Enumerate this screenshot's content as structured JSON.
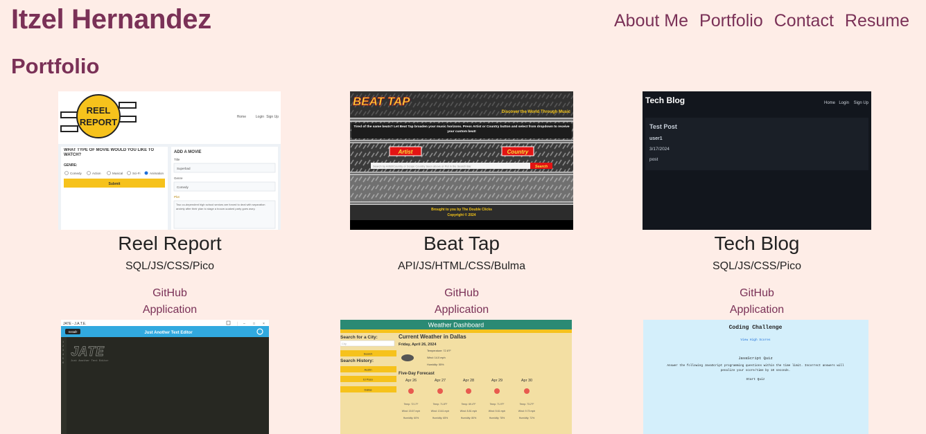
{
  "header": {
    "site_title": "Itzel Hernandez",
    "nav": [
      "About Me",
      "Portfolio",
      "Contact",
      "Resume"
    ]
  },
  "section_title": "Portfolio",
  "projects": [
    {
      "title": "Reel Report",
      "stack": "SQL/JS/CSS/Pico",
      "github": "GitHub",
      "app": "Application",
      "thumb": {
        "logo_line1": "REEL",
        "logo_line2": "REPORT",
        "nav": [
          "Home",
          "Login",
          "Sign Up"
        ],
        "question": "WHAT TYPE OF MOVIE WOULD YOU LIKE TO WATCH?",
        "genre_label": "GENRE:",
        "genres": [
          "Comedy",
          "Action",
          "Musical",
          "Sci-Fi",
          "Animation"
        ],
        "submit": "Submit",
        "add_title": "ADD A MOVIE",
        "field_title_label": "Title",
        "field_title_value": "Superbad",
        "field_genre_label": "Genre",
        "field_genre_value": "Comedy",
        "field_plot_label": "Plot",
        "field_plot_value": "Two co-dependent high school seniors are forced to deal with separation anxiety after their plan to stage a booze-soaked party goes awry."
      }
    },
    {
      "title": "Beat Tap",
      "stack": "API/JS/HTML/CSS/Bulma",
      "github": "GitHub",
      "app": "Application",
      "thumb": {
        "logo": "BEAT TAP",
        "tagline": "Discover the World Through Music",
        "intro": "Tired of the same beats? Let Beat Tap broaden your music horizons. Press Artist or Country button and select from dropdown to receive your custom beat!",
        "artist_button": "Artist",
        "country_button": "Country",
        "search_placeholder": "Search by Artist/Country or Scope Country Seen above or Put in the Search Bar",
        "search_button": "Search",
        "footer_line1": "Brought to you by The Double Clicks",
        "footer_line2": "Copyright © 2024"
      }
    },
    {
      "title": "Tech Blog",
      "stack": "SQL/JS/CSS/Pico",
      "github": "GitHub",
      "app": "Application",
      "thumb": {
        "brand": "Tech Blog",
        "nav": [
          "Home",
          "Login",
          "Sign Up"
        ],
        "post_title": "Test Post",
        "post_user": "user1",
        "post_date": "3/17/2024",
        "post_body": "post"
      }
    }
  ],
  "row2": {
    "editor": {
      "window_title": "JATE - J.A.T.E.",
      "install": "Install!",
      "app_title": "Just Another Text Editor",
      "logo": "JATE",
      "subtitle": "Just Another Text Editor"
    },
    "weather": {
      "title": "Weather Dashboard",
      "search_label": "Search for a City:",
      "search_placeholder": "City",
      "search_button": "Search",
      "history_label": "Search History:",
      "history": [
        "Austin",
        "El Paso",
        "Dallas"
      ],
      "current_title": "Current Weather in Dallas",
      "current_date": "Friday, April 26, 2024",
      "current_temp": "Temperature: 72.6°F",
      "current_wind": "Wind: 14.0 mph",
      "current_humidity": "Humidity: 55%",
      "forecast_title": "Five-Day Forecast",
      "forecast": [
        {
          "day": "Apr 26",
          "temp": "Temp: 72.1°F",
          "wind": "Wind: 15.57 mph",
          "hum": "Humidity: 60%"
        },
        {
          "day": "Apr 27",
          "temp": "Temp: 71.8°F",
          "wind": "Wind: 13.61 mph",
          "hum": "Humidity: 65%"
        },
        {
          "day": "Apr 28",
          "temp": "Temp: 69.4°F",
          "wind": "Wind: 8.81 mph",
          "hum": "Humidity: 80%"
        },
        {
          "day": "Apr 29",
          "temp": "Temp: 71.9°F",
          "wind": "Wind: 5.61 mph",
          "hum": "Humidity: 78%"
        },
        {
          "day": "Apr 30",
          "temp": "Temp: 73.2°F",
          "wind": "Wind: 9.73 mph",
          "hum": "Humidity: 72%"
        }
      ]
    },
    "quiz": {
      "title": "Coding Challenge",
      "highscores": "View High Scores",
      "quiz_title": "JavaScript Quiz",
      "instructions_1": "Answer the following JavaScript programming questions within the time limit. Incorrect answers will",
      "instructions_2": "penalize your score/time by 10 seconds.",
      "start": "Start Quiz"
    }
  },
  "colors": {
    "background": "#feede7",
    "accent": "#7a3157"
  }
}
